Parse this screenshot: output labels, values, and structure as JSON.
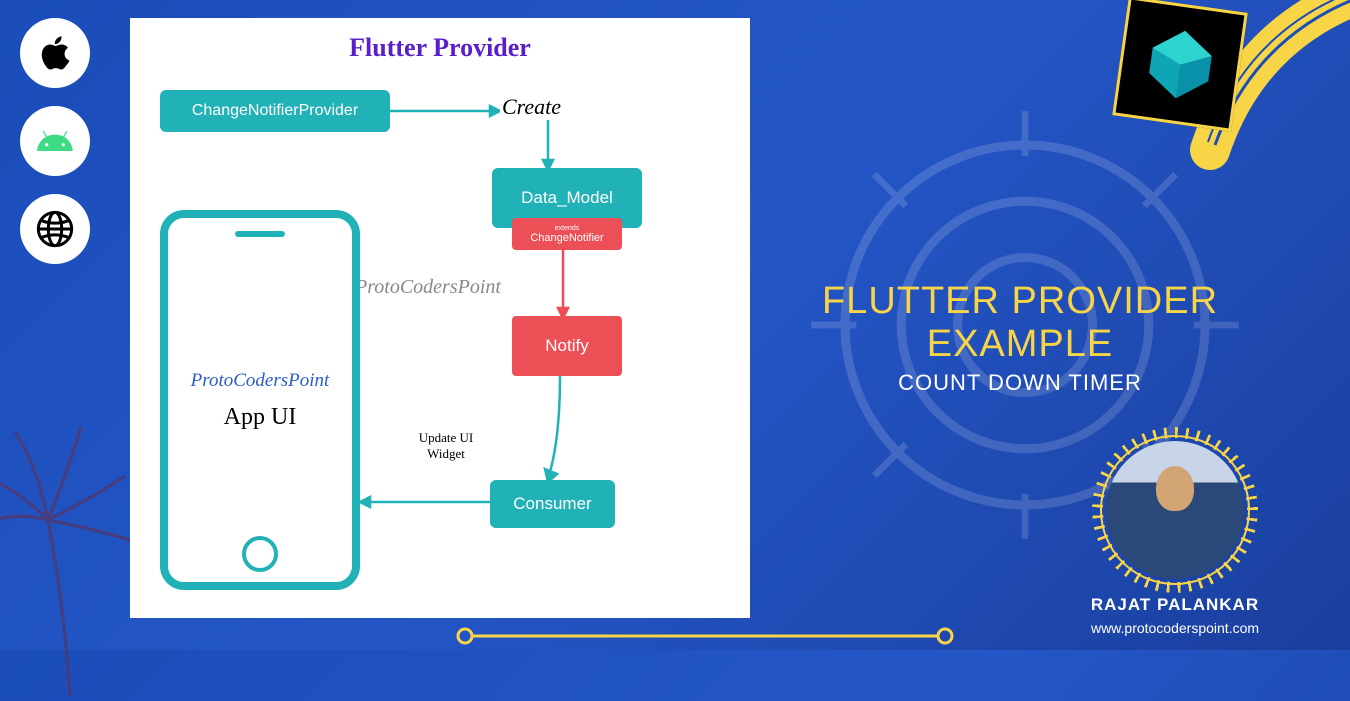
{
  "diagram": {
    "title": "Flutter Provider",
    "change_notifier_provider": "ChangeNotifierProvider",
    "create_label": "Create",
    "data_model": "Data_Model",
    "change_notifier_extends": "extends",
    "change_notifier": "ChangeNotifier",
    "notify": "Notify",
    "consumer": "Consumer",
    "update_ui_widget": "Update UI Widget",
    "watermark": "ProtoCodersPoint"
  },
  "phone": {
    "brand": "ProtoCodersPoint",
    "app_ui": "App UI"
  },
  "headline": {
    "line1": "FLUTTER PROVIDER EXAMPLE",
    "line2": "COUNT DOWN TIMER"
  },
  "author": {
    "name": "RAJAT PALANKAR",
    "site": "www.protocoderspoint.com"
  },
  "icons": {
    "apple": "apple-icon",
    "android": "android-icon",
    "web": "globe-icon"
  }
}
